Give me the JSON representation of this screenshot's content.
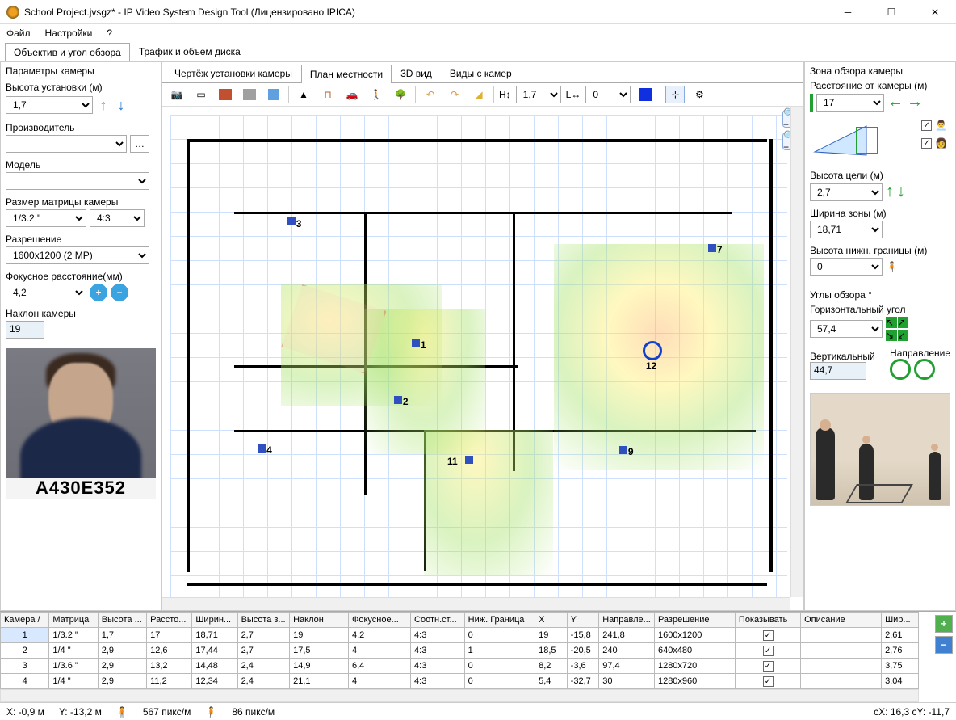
{
  "window": {
    "title": "School Project.jvsgz* - IP Video System Design Tool (Лицензировано  IPICA)"
  },
  "menu": {
    "file": "Файл",
    "settings": "Настройки",
    "help": "?"
  },
  "top_tabs": {
    "lens": "Объектив и угол обзора",
    "traffic": "Трафик и объем диска"
  },
  "left": {
    "section": "Параметры камеры",
    "install_height_label": "Высота установки (м)",
    "install_height": "1,7",
    "manufacturer_label": "Производитель",
    "manufacturer": "",
    "model_label": "Модель",
    "model": "",
    "sensor_label": "Размер матрицы камеры",
    "sensor": "1/3.2 \"",
    "aspect": "4:3",
    "resolution_label": "Разрешение",
    "resolution": "1600x1200 (2 MP)",
    "focal_label": "Фокусное расстояние(мм)",
    "focal": "4,2",
    "tilt_label": "Наклон камеры",
    "tilt": "19",
    "plate": "A430E352"
  },
  "center_tabs": {
    "install": "Чертёж установки камеры",
    "plan": "План местности",
    "view3d": "3D вид",
    "camviews": "Виды с камер"
  },
  "toolbar": {
    "h_label": "H↕",
    "h_val": "1,7",
    "l_label": "L↔",
    "l_val": "0"
  },
  "cameras": [
    "1",
    "2",
    "3",
    "4",
    "7",
    "9",
    "11",
    "12"
  ],
  "right": {
    "zone_title": "Зона обзора камеры",
    "dist_label": "Расстояние от камеры (м)",
    "dist": "17",
    "target_h_label": "Высота цели (м)",
    "target_h": "2,7",
    "zone_w_label": "Ширина зоны (м)",
    "zone_w": "18,71",
    "lower_h_label": "Высота нижн. границы (м)",
    "lower_h": "0",
    "angles_title": "Углы обзора °",
    "horiz_label": "Горизонтальный угол",
    "horiz": "57,4",
    "vert_label": "Вертикальный",
    "vert": "44,7",
    "dir_label": "Направление"
  },
  "table": {
    "headers": [
      "Камера  /",
      "Матрица",
      "Высота ...",
      "Рассто...",
      "Ширин...",
      "Высота з...",
      "Наклон",
      "Фокусное...",
      "Соотн.ст...",
      "Ниж. Граница",
      "X",
      "Y",
      "Направле...",
      "Разрешение",
      "Показывать",
      "Описание",
      "Шир..."
    ],
    "rows": [
      [
        "1",
        "1/3.2 \"",
        "1,7",
        "17",
        "18,71",
        "2,7",
        "19",
        "4,2",
        "4:3",
        "0",
        "19",
        "-15,8",
        "241,8",
        "1600x1200",
        "✓",
        "",
        "2,61"
      ],
      [
        "2",
        "1/4 \"",
        "2,9",
        "12,6",
        "17,44",
        "2,7",
        "17,5",
        "4",
        "4:3",
        "1",
        "18,5",
        "-20,5",
        "240",
        "640x480",
        "✓",
        "",
        "2,76"
      ],
      [
        "3",
        "1/3.6 \"",
        "2,9",
        "13,2",
        "14,48",
        "2,4",
        "14,9",
        "6,4",
        "4:3",
        "0",
        "8,2",
        "-3,6",
        "97,4",
        "1280x720",
        "✓",
        "",
        "3,75"
      ],
      [
        "4",
        "1/4 \"",
        "2,9",
        "11,2",
        "12,34",
        "2,4",
        "21,1",
        "4",
        "4:3",
        "0",
        "5,4",
        "-32,7",
        "30",
        "1280x960",
        "✓",
        "",
        "3,04"
      ]
    ]
  },
  "status": {
    "x": "X: -0,9 м",
    "y": "Y: -13,2 м",
    "px1": "567 пикс/м",
    "px2": "86 пикс/м",
    "cxy": "cX: 16,3 cY: -11,7"
  }
}
